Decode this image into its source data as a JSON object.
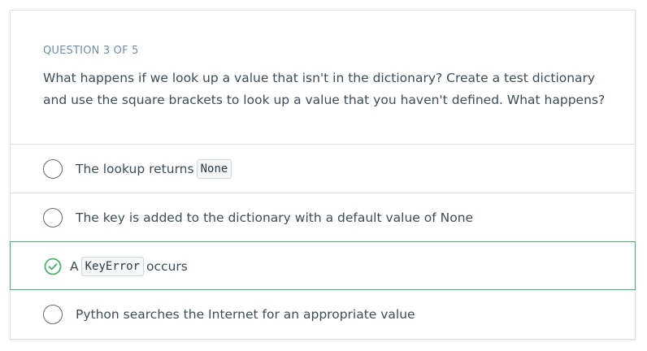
{
  "question": {
    "number_label": "QUESTION 3 OF 5",
    "text": "What happens if we look up a value that isn't in the dictionary? Create a test dictionary and use the square brackets to look up a value that you haven't defined. What happens?"
  },
  "options": [
    {
      "before": "The lookup returns",
      "code": "None",
      "after": "",
      "state": "unselected"
    },
    {
      "before": "The key is added to the dictionary with a default value of None",
      "code": "",
      "after": "",
      "state": "unselected"
    },
    {
      "before": "A",
      "code": "KeyError",
      "after": "occurs",
      "state": "correct"
    },
    {
      "before": "Python searches the Internet for an appropriate value",
      "code": "",
      "after": "",
      "state": "unselected"
    }
  ],
  "colors": {
    "correct": "#4caf6e",
    "question_number": "#6f8fa5",
    "text": "#3c4d57"
  },
  "icons": {
    "unselected": "radio-empty-icon",
    "correct": "check-circle-icon"
  }
}
